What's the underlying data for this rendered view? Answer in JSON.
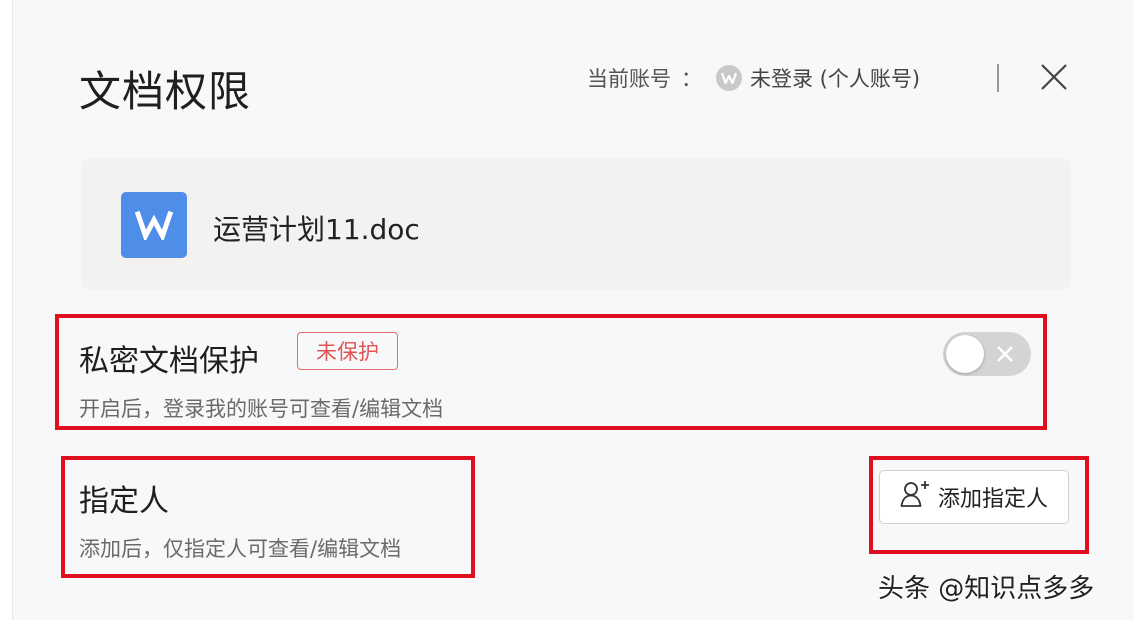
{
  "dialog": {
    "title": "文档权限",
    "account_label": "当前账号",
    "account_colon": "：",
    "account_status": "未登录 (个人账号)",
    "close_icon": "close-icon"
  },
  "file": {
    "icon_letter": "W",
    "name": "运营计划11.doc",
    "icon_color": "#4e8de8"
  },
  "private_protection": {
    "title": "私密文档保护",
    "badge": "未保护",
    "description": "开启后，登录我的账号可查看/编辑文档",
    "toggle_on": false
  },
  "designated": {
    "title": "指定人",
    "description": "添加后，仅指定人可查看/编辑文档",
    "add_button_label": "添加指定人",
    "add_button_icon": "add-user-icon"
  },
  "watermark": "头条 @知识点多多",
  "colors": {
    "highlight_border": "#dd1020",
    "badge_red": "#e05555",
    "accent_blue": "#4e8de8"
  }
}
